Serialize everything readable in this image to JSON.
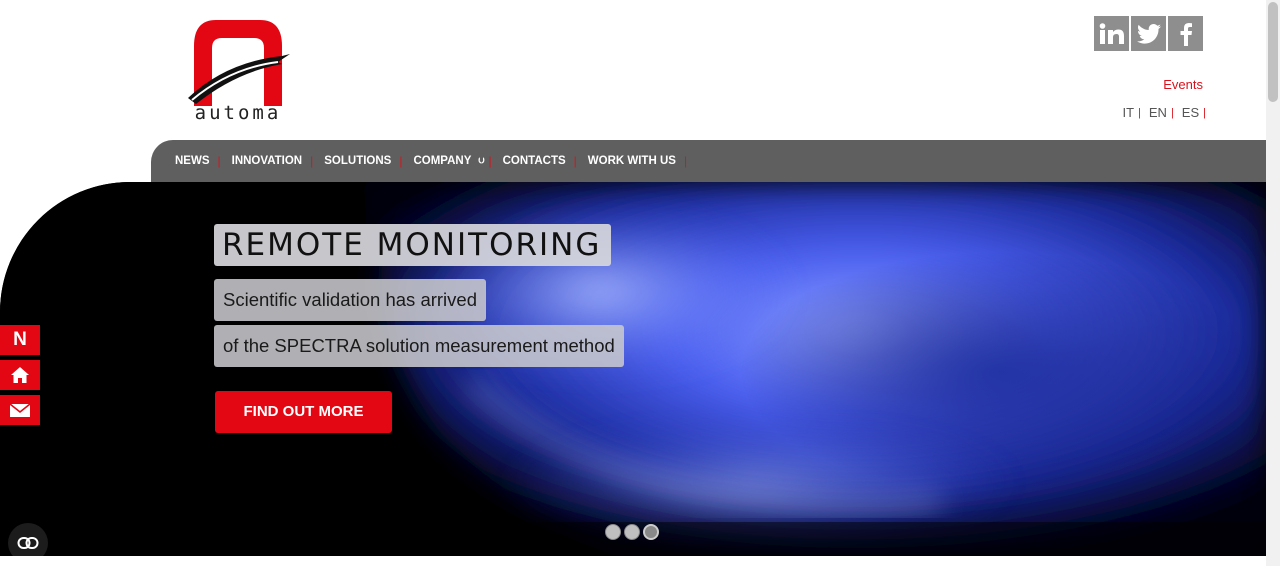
{
  "brand": {
    "name": "automa"
  },
  "header": {
    "social": [
      {
        "icon": "linkedin-icon",
        "label": "in"
      },
      {
        "icon": "twitter-icon",
        "label": ""
      },
      {
        "icon": "facebook-icon",
        "label": "f"
      }
    ],
    "events_label": "Events",
    "languages": [
      "IT",
      "EN",
      "ES"
    ]
  },
  "nav": {
    "items": [
      {
        "label": "NEWS"
      },
      {
        "label": "INNOVATION"
      },
      {
        "label": "SOLUTIONS"
      },
      {
        "label": "COMPANY"
      },
      {
        "label": "CONTACTS"
      },
      {
        "label": "WORK WITH US"
      }
    ]
  },
  "hero": {
    "title": "REMOTE MONITORING",
    "line1": "Scientific validation has arrived",
    "line2": "of the SPECTRA solution measurement method",
    "cta_label": "FIND OUT MORE",
    "slide_count": 3,
    "active_slide": 3
  },
  "side_buttons": {
    "n_label": "N"
  },
  "colors": {
    "accent": "#e30613",
    "nav_bg": "#5f5f5f",
    "social_bg": "#8e8e8e"
  }
}
